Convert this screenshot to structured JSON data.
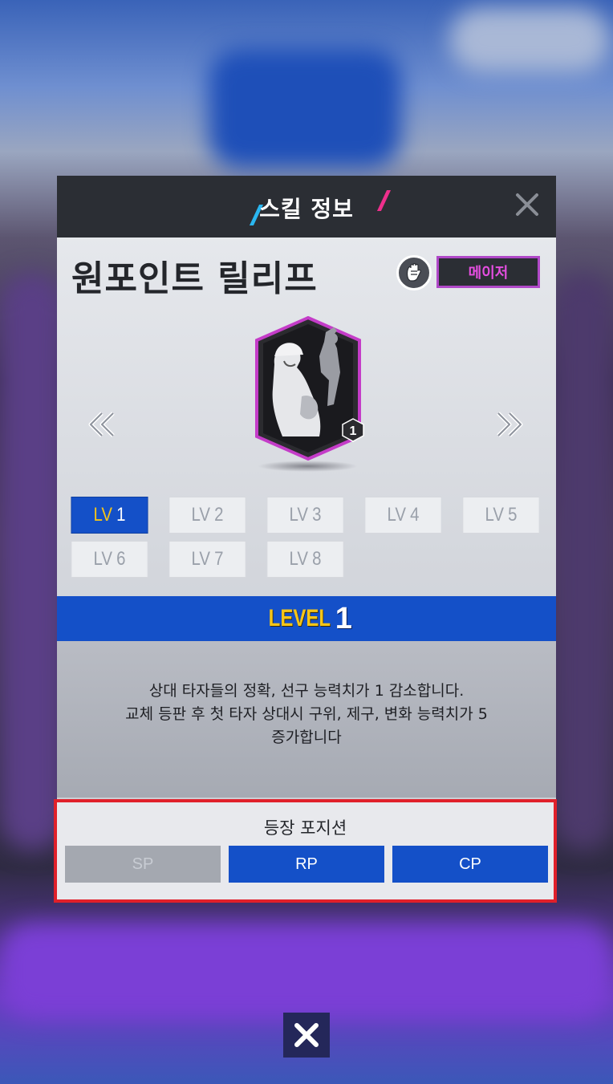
{
  "dialog": {
    "title": "스킬 정보",
    "skill_name": "원포인트 릴리프",
    "category_badge": "메이저",
    "card_level": "1",
    "levels": [
      {
        "prefix": "LV",
        "num": "1",
        "active": true
      },
      {
        "prefix": "LV",
        "num": "2",
        "active": false
      },
      {
        "prefix": "LV",
        "num": "3",
        "active": false
      },
      {
        "prefix": "LV",
        "num": "4",
        "active": false
      },
      {
        "prefix": "LV",
        "num": "5",
        "active": false
      },
      {
        "prefix": "LV",
        "num": "6",
        "active": false
      },
      {
        "prefix": "LV",
        "num": "7",
        "active": false
      },
      {
        "prefix": "LV",
        "num": "8",
        "active": false
      }
    ],
    "level_bar": {
      "word": "LEVEL",
      "num": "1"
    },
    "description": "상대 타자들의 정확, 선구 능력치가 1 감소합니다.\n교체 등판 후 첫 타자 상대시 구위, 제구, 변화 능력치가 5\n증가합니다",
    "positions": {
      "title": "등장 포지션",
      "items": [
        {
          "label": "SP",
          "enabled": false
        },
        {
          "label": "RP",
          "enabled": true
        },
        {
          "label": "CP",
          "enabled": true
        }
      ]
    }
  },
  "colors": {
    "accent_blue": "#1450c8",
    "badge_pink": "#e54ee0",
    "highlight_red": "#e0202a",
    "level_gold": "#f5c518"
  },
  "icons": {
    "close": "close-icon",
    "glove": "glove-icon",
    "prev": "chevron-double-left-icon",
    "next": "chevron-double-right-icon",
    "bottom_close": "close-icon"
  }
}
